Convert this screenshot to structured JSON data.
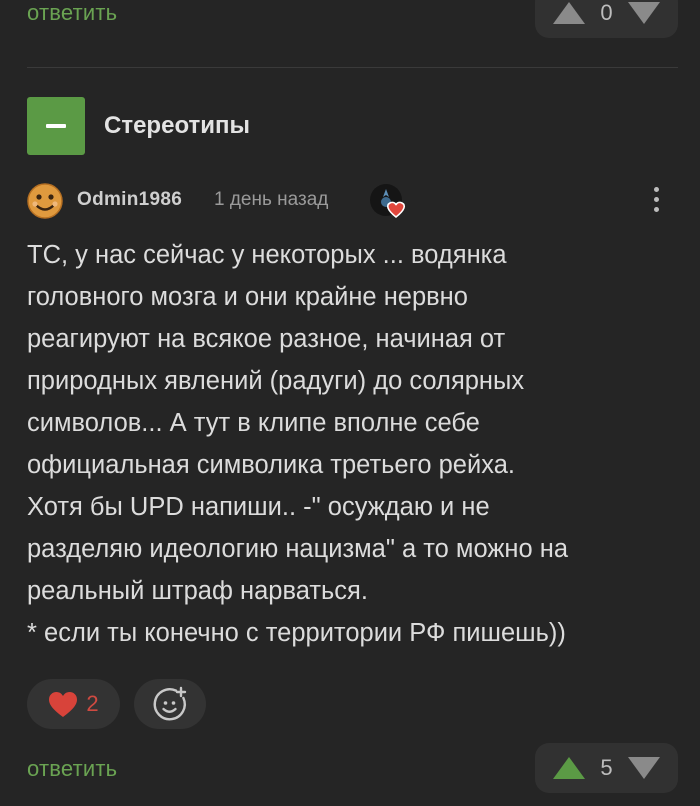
{
  "previous_comment": {
    "reply_label": "ответить",
    "rating": "0"
  },
  "thread": {
    "title": "Стереотипы"
  },
  "comment": {
    "author": "Odmin1986",
    "time": "1 день назад",
    "body_lines": [
      "ТС, у нас сейчас у некоторых ... водянка",
      "головного мозга и они крайне нервно",
      "реагируют на всякое разное, начиная от",
      "природных явлений (радуги) до солярных",
      "символов... А тут в клипе вполне себе",
      "официальная символика третьего рейха.",
      "Хотя бы UPD напиши.. -\" осуждаю и не",
      "разделяю идеологию нацизма\" а то можно на",
      "реальный штраф нарваться.",
      "* если ты конечно с территории РФ пишешь))"
    ],
    "reactions": {
      "heart_count": "2"
    },
    "reply_label": "ответить",
    "rating": "5"
  },
  "colors": {
    "accent_green": "#5b9a45",
    "reaction_red": "#d8433a",
    "background": "#252525"
  },
  "icons": [
    "arrow-up-icon",
    "arrow-down-icon",
    "minus-icon",
    "avatar-smiley",
    "heart-badge-icon",
    "more-vertical-icon",
    "heart-icon",
    "add-reaction-icon"
  ]
}
